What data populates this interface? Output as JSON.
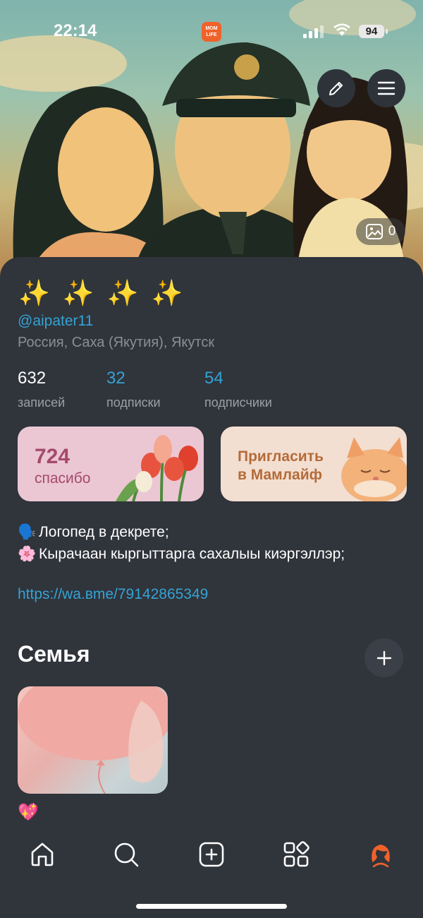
{
  "status_bar": {
    "time": "22:14",
    "app_badge": "MOM LIFE",
    "battery": "94"
  },
  "cover": {
    "photos_count": "0"
  },
  "profile": {
    "display_name": "✨ ✨ ✨ ✨",
    "username": "@aipater11",
    "location": "Россия, Саха (Якутия), Якутск",
    "stats": [
      {
        "value": "632",
        "label": "записей"
      },
      {
        "value": "32",
        "label": "подписки"
      },
      {
        "value": "54",
        "label": "подписчики"
      }
    ]
  },
  "cards": {
    "thanks": {
      "value": "724",
      "label": "спасибо"
    },
    "invite": {
      "label_line1": "Пригласить",
      "label_line2": "в Мамлайф"
    }
  },
  "bio": {
    "line1_emoji": "🗣️",
    "line1": "Логопед в декрете;",
    "line2_emoji": "🌸",
    "line2": "Кырачаан кыргыттарга сахалыы киэргэллэр;",
    "link": "https://wa.вme/79142865349"
  },
  "family_section": {
    "title": "Семья",
    "album_label": "💖"
  },
  "tab_bar": {
    "tabs": [
      "home-icon",
      "search-icon",
      "create-icon",
      "catalog-icon",
      "profile-icon"
    ]
  },
  "colors": {
    "background": "#30343b",
    "accent_blue": "#34a3d4",
    "thanks_card": "#ebc7d3",
    "invite_card": "#f3dfd1",
    "profile_tab": "#f0622a"
  }
}
